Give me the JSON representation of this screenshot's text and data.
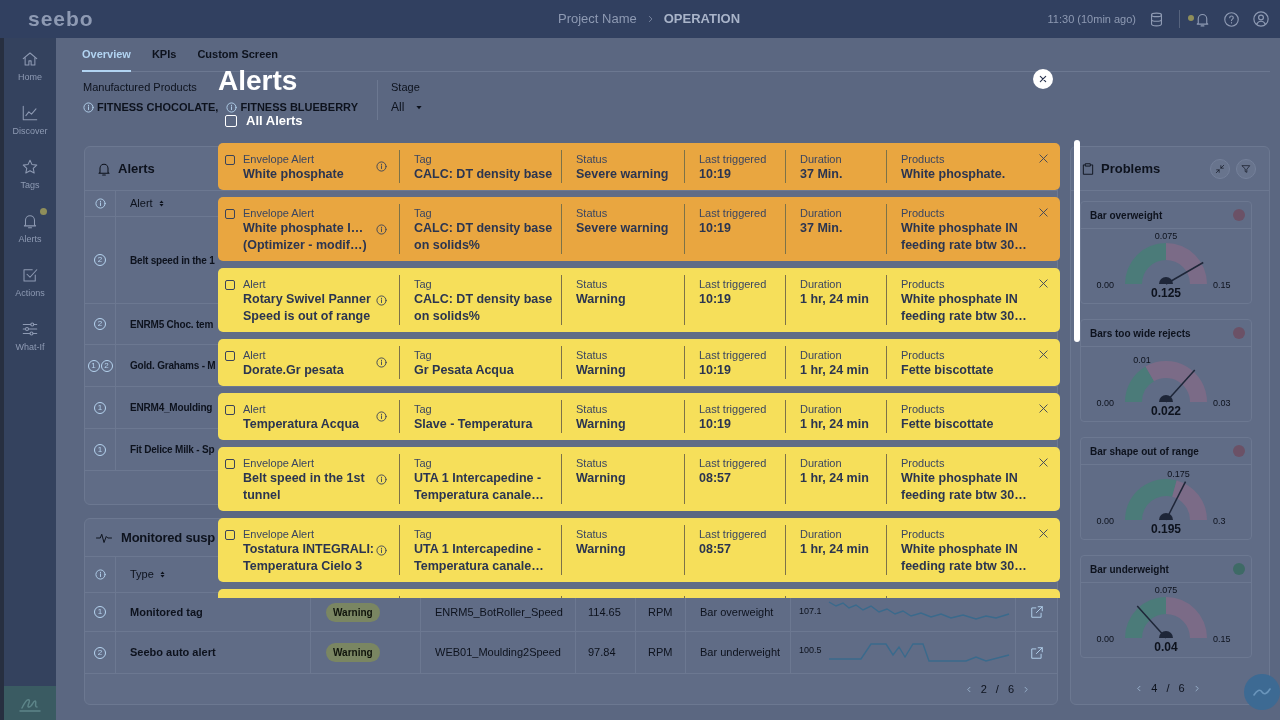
{
  "header": {
    "logo": "seebo",
    "project": "Project Name",
    "page": "OPERATION",
    "updated": "11:30 (10min ago)",
    "notification_dot": true
  },
  "sidebar": [
    {
      "kind": "home",
      "label": "Home",
      "dot": false
    },
    {
      "kind": "discover",
      "label": "Discover",
      "dot": false
    },
    {
      "kind": "tags",
      "label": "Tags",
      "dot": false
    },
    {
      "kind": "alerts",
      "label": "Alerts",
      "dot": true
    },
    {
      "kind": "actions",
      "label": "Actions",
      "dot": false
    },
    {
      "kind": "whatif",
      "label": "What-If",
      "dot": false
    }
  ],
  "tabs": [
    {
      "label": "Overview",
      "selected": true
    },
    {
      "label": "KPIs",
      "selected": false
    },
    {
      "label": "Custom Screen",
      "selected": false
    }
  ],
  "filters": {
    "products_label": "Manufactured Products",
    "products": [
      "FITNESS CHOCOLATE,",
      "FITNESS BLUEBERRY"
    ],
    "stage_label": "Stage",
    "stage": "All"
  },
  "alerts_panel": {
    "title": "Alerts",
    "column": "Alert",
    "rows": [
      {
        "markers": [
          "2"
        ],
        "alert": "Belt speed in the 1"
      },
      {
        "markers": [
          "2"
        ],
        "alert": "ENRM5 Choc. tem"
      },
      {
        "markers": [
          "1",
          "2"
        ],
        "alert": "Gold. Grahams - M"
      },
      {
        "markers": [
          "1"
        ],
        "alert": "ENRM4_Moulding"
      },
      {
        "markers": [
          "1"
        ],
        "alert": "Fit Delice Milk - Sp"
      }
    ]
  },
  "suspects_panel": {
    "title": "Monitored susp",
    "column": "Type",
    "rows": [
      {
        "markers": [
          "1"
        ],
        "type": "Monitored tag",
        "status": "Warning",
        "tag": "ENRM5_BotRoller_Speed",
        "value": "114.65",
        "unit": "RPM",
        "problem": "Bar overweight",
        "trend_label": "107.1"
      },
      {
        "markers": [
          "2"
        ],
        "type": "Seebo auto alert",
        "status": "Warning",
        "tag": "WEB01_Moulding2Speed",
        "value": "97.84",
        "unit": "RPM",
        "problem": "Bar underweight",
        "trend_label": "100.5"
      }
    ],
    "pagination": {
      "page": "2",
      "separator": "/",
      "pages": "6"
    }
  },
  "problems_panel": {
    "title": "Problems",
    "gauges": [
      {
        "name": "Bar overweight",
        "color": "#6b5166",
        "threshold_label": "0.075",
        "min": "0.00",
        "max": "0.15",
        "value": "0.125"
      },
      {
        "name": "Bars too wide rejects",
        "color": "#6b5166",
        "threshold_label": "0.01",
        "min": "0.00",
        "max": "0.03",
        "value": "0.022"
      },
      {
        "name": "Bar shape out of range",
        "color": "#6b5166",
        "threshold_label": "0.175",
        "min": "0.00",
        "max": "0.3",
        "value": "0.195"
      },
      {
        "name": "Bar underweight",
        "color": "#3e6a66",
        "threshold_label": "0.075",
        "min": "0.00",
        "max": "0.15",
        "value": "0.04"
      }
    ],
    "pagination": {
      "page": "4",
      "separator": "/",
      "pages": "6"
    }
  },
  "modal": {
    "title": "Alerts",
    "select_all": {
      "label": "All Alerts",
      "checked": false
    },
    "alerts": [
      {
        "color": "#e9a640",
        "checked": false,
        "type": "Envelope Alert",
        "name": "White phosphate",
        "fields": [
          {
            "label": "Tag",
            "value": "CALC: DT density base"
          },
          {
            "label": "Status",
            "value": "Severe warning"
          },
          {
            "label": "Last triggered",
            "value": "10:19"
          },
          {
            "label": "Duration",
            "value": "37 Min."
          },
          {
            "label": "Products",
            "value": "White phosphate."
          }
        ]
      },
      {
        "color": "#e9a640",
        "checked": false,
        "type": "Envelope Alert",
        "name": "White phosphate I…\n(Optimizer - modif…)",
        "fields": [
          {
            "label": "Tag",
            "value": "CALC: DT density base\non solids%"
          },
          {
            "label": "Status",
            "value": "Severe warning"
          },
          {
            "label": "Last triggered",
            "value": "10:19"
          },
          {
            "label": "Duration",
            "value": "37 Min."
          },
          {
            "label": "Products",
            "value": "White phosphate IN\nfeeding rate btw 30…"
          }
        ]
      },
      {
        "color": "#f6df5a",
        "checked": false,
        "type": "Alert",
        "name": "Rotary Swivel Panner\nSpeed is out of range",
        "fields": [
          {
            "label": "Tag",
            "value": "CALC: DT density base\non solids%"
          },
          {
            "label": "Status",
            "value": "Warning"
          },
          {
            "label": "Last triggered",
            "value": "10:19"
          },
          {
            "label": "Duration",
            "value": "1 hr, 24 min"
          },
          {
            "label": "Products",
            "value": "White phosphate IN\nfeeding rate btw 30…"
          }
        ]
      },
      {
        "color": "#f6df5a",
        "checked": false,
        "type": "Alert",
        "name": "Dorate.Gr pesata",
        "fields": [
          {
            "label": "Tag",
            "value": "Gr Pesata Acqua"
          },
          {
            "label": "Status",
            "value": "Warning"
          },
          {
            "label": "Last triggered",
            "value": "10:19"
          },
          {
            "label": "Duration",
            "value": "1 hr, 24 min"
          },
          {
            "label": "Products",
            "value": "Fette biscottate"
          }
        ]
      },
      {
        "color": "#f6df5a",
        "checked": false,
        "type": "Alert",
        "name": "Temperatura Acqua",
        "fields": [
          {
            "label": "Tag",
            "value": "Slave - Temperatura"
          },
          {
            "label": "Status",
            "value": "Warning"
          },
          {
            "label": "Last triggered",
            "value": "10:19"
          },
          {
            "label": "Duration",
            "value": "1 hr, 24 min"
          },
          {
            "label": "Products",
            "value": "Fette biscottate"
          }
        ]
      },
      {
        "color": "#f6df5a",
        "checked": false,
        "type": "Envelope Alert",
        "name": "Belt speed in the 1st\ntunnel",
        "fields": [
          {
            "label": "Tag",
            "value": "UTA 1 Intercapedine -\nTemperatura canale…"
          },
          {
            "label": "Status",
            "value": "Warning"
          },
          {
            "label": "Last triggered",
            "value": "08:57"
          },
          {
            "label": "Duration",
            "value": "1 hr, 24 min"
          },
          {
            "label": "Products",
            "value": "White phosphate IN\nfeeding rate btw 30…"
          }
        ]
      },
      {
        "color": "#f6df5a",
        "checked": false,
        "type": "Envelope Alert",
        "name": "Tostatura INTEGRALI:\nTemperatura Cielo 3",
        "fields": [
          {
            "label": "Tag",
            "value": "UTA 1 Intercapedine -\nTemperatura canale…"
          },
          {
            "label": "Status",
            "value": "Warning"
          },
          {
            "label": "Last triggered",
            "value": "08:57"
          },
          {
            "label": "Duration",
            "value": "1 hr, 24 min"
          },
          {
            "label": "Products",
            "value": "White phosphate IN\nfeeding rate btw 30…"
          }
        ]
      },
      {
        "color": "#f6df5a"
      }
    ]
  }
}
